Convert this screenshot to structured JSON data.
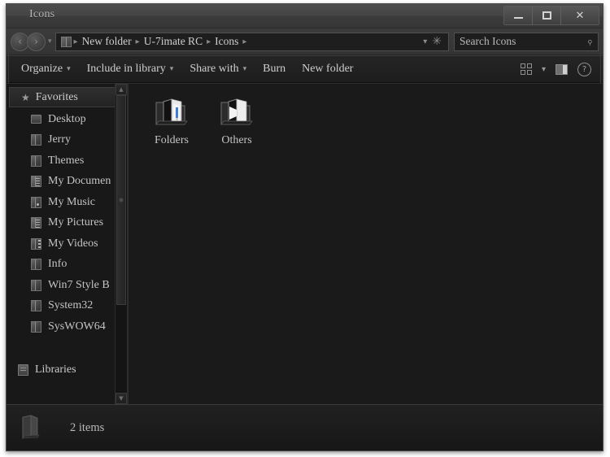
{
  "window": {
    "title": "Icons",
    "controls": {
      "minimize": "minimize-button",
      "maximize": "maximize-button",
      "close": "✕"
    }
  },
  "address_bar": {
    "back_glyph": "‹",
    "forward_glyph": "›",
    "history_caret": "▾",
    "breadcrumbs": [
      "New folder",
      "U-7imate RC",
      "Icons"
    ],
    "separator": "▸",
    "dropdown_caret": "▾",
    "refresh_glyph": "✳"
  },
  "search": {
    "placeholder": "Search Icons",
    "icon": "⌕"
  },
  "toolbar": {
    "items": [
      {
        "label": "Organize",
        "has_caret": true
      },
      {
        "label": "Include in library",
        "has_caret": true
      },
      {
        "label": "Share with",
        "has_caret": true
      },
      {
        "label": "Burn",
        "has_caret": false
      },
      {
        "label": "New folder",
        "has_caret": false
      }
    ],
    "view_caret": "▾",
    "help_glyph": "?"
  },
  "sidebar": {
    "sections": [
      {
        "type": "section",
        "label": "Favorites",
        "icon": "star-icon"
      }
    ],
    "items": [
      {
        "label": "Desktop",
        "icon": "desktop-icon"
      },
      {
        "label": "Jerry",
        "icon": "folder-icon"
      },
      {
        "label": "Themes",
        "icon": "folder-icon"
      },
      {
        "label": "My Documen",
        "icon": "documents-icon"
      },
      {
        "label": "My Music",
        "icon": "music-folder-icon"
      },
      {
        "label": "My Pictures",
        "icon": "pictures-folder-icon"
      },
      {
        "label": "My Videos",
        "icon": "videos-folder-icon"
      },
      {
        "label": "Info",
        "icon": "folder-icon"
      },
      {
        "label": "Win7 Style B",
        "icon": "folder-icon"
      },
      {
        "label": "System32",
        "icon": "folder-icon"
      },
      {
        "label": "SysWOW64",
        "icon": "folder-icon"
      }
    ],
    "groups": [
      {
        "label": "Libraries",
        "icon": "libraries-icon"
      }
    ],
    "scrollbar": {
      "up_glyph": "▲",
      "down_glyph": "▼"
    }
  },
  "content": {
    "items": [
      {
        "label": "Folders",
        "icon": "open-folder-icon"
      },
      {
        "label": "Others",
        "icon": "open-folder-icon"
      }
    ]
  },
  "status": {
    "text": "2 items",
    "icon": "folder-icon"
  },
  "colors": {
    "window_background": "#1c1c1c",
    "content_background": "#1a1a1a",
    "titlebar_top": "#4c4c4c",
    "text_primary": "#cfcfcf",
    "text_secondary": "#b9b9b9",
    "accent_blue": "#3f7fd0"
  }
}
